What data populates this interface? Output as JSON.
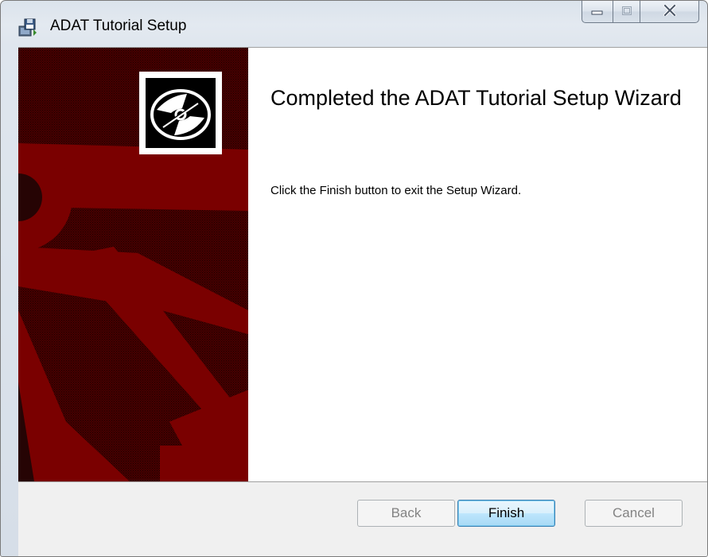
{
  "window": {
    "title": "ADAT Tutorial Setup",
    "caption_buttons": {
      "minimize_icon": "minimize-icon",
      "maximize_icon": "maximize-icon",
      "close_icon": "close-icon"
    }
  },
  "wizard": {
    "heading": "Completed the ADAT Tutorial Setup Wizard",
    "description": "Click the Finish button to exit the Setup Wizard.",
    "banner_logo_icon": "disc-icon"
  },
  "buttons": {
    "back_label": "Back",
    "finish_label": "Finish",
    "cancel_label": "Cancel",
    "back_enabled": false,
    "cancel_enabled": false
  },
  "colors": {
    "banner_red": "#7a0000",
    "banner_dark": "#1c0000",
    "default_button_border": "#3c7fb1"
  }
}
